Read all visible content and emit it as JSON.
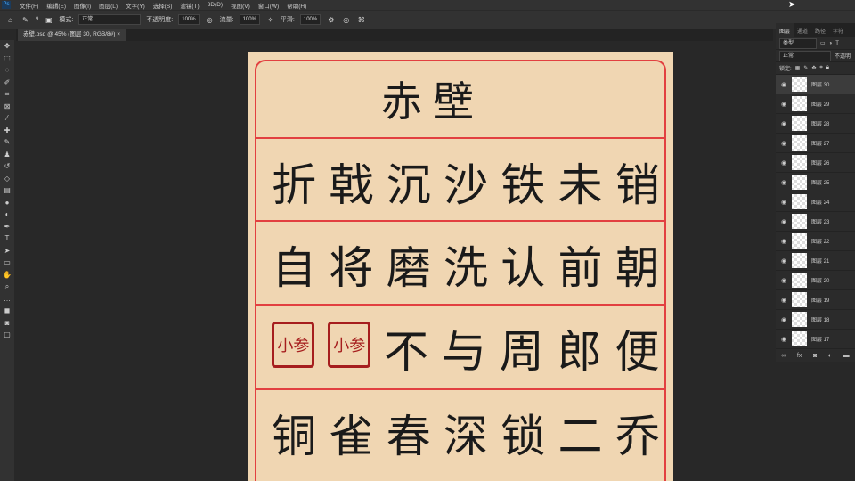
{
  "app": {
    "logo": "Ps"
  },
  "menu": [
    "文件(F)",
    "编辑(E)",
    "图像(I)",
    "图层(L)",
    "文字(Y)",
    "选择(S)",
    "滤镜(T)",
    "3D(D)",
    "视图(V)",
    "窗口(W)",
    "帮助(H)"
  ],
  "options": {
    "brush_size": "9",
    "mode_label": "模式:",
    "mode_value": "正常",
    "opacity_label": "不透明度:",
    "opacity_value": "100%",
    "flow_label": "流量:",
    "flow_value": "100%",
    "smooth_label": "平滑:",
    "smooth_value": "100%"
  },
  "document_tab": {
    "title": "赤壁.psd @ 45% (图层 30, RGB/8#)",
    "close": "×"
  },
  "poem": {
    "title": "赤壁",
    "rows": [
      [
        "折",
        "戟",
        "沉",
        "沙",
        "铁",
        "未",
        "销"
      ],
      [
        "自",
        "将",
        "磨",
        "洗",
        "认",
        "前",
        "朝"
      ],
      [
        "不",
        "与",
        "周",
        "郎",
        "便"
      ],
      [
        "铜",
        "雀",
        "春",
        "深",
        "锁",
        "二",
        "乔"
      ]
    ],
    "seals": [
      "小参",
      "小参"
    ]
  },
  "layers_panel": {
    "tabs": [
      "图层",
      "通道",
      "路径",
      "字符"
    ],
    "filter": "类型",
    "blend": "正常",
    "opacity_label": "不透明",
    "lock_label": "锁定:",
    "layers": [
      "图层 30",
      "图层 29",
      "图层 28",
      "图层 27",
      "图层 26",
      "图层 25",
      "图层 24",
      "图层 23",
      "图层 22",
      "图层 21",
      "图层 20",
      "图层 19",
      "图层 18",
      "图层 17"
    ]
  },
  "colors": {
    "frame": "#e24040",
    "paper": "#f0d6b2",
    "seal": "#a61e1e"
  }
}
